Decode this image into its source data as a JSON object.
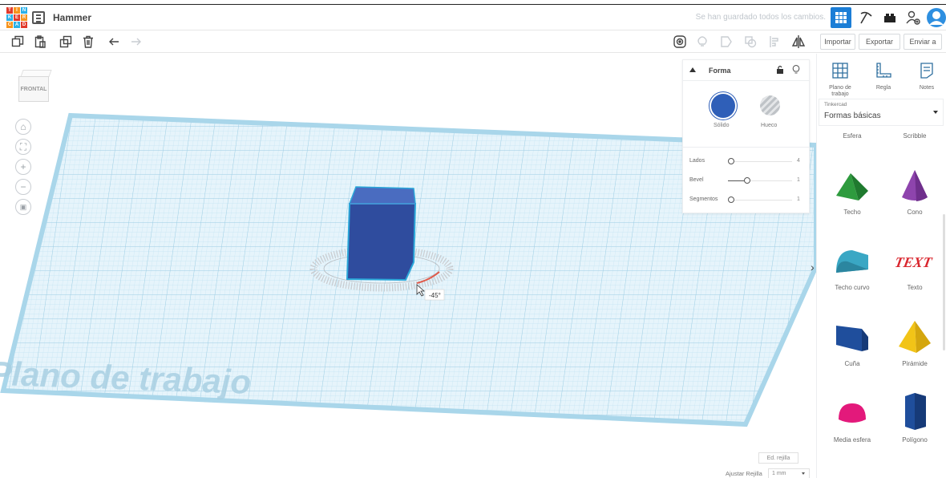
{
  "app": {
    "logo_letters": [
      "T",
      "I",
      "N",
      "K",
      "E",
      "R",
      "C",
      "A",
      "D"
    ],
    "logo_colors": [
      "#e23a2b",
      "#f7941d",
      "#2bb0e8",
      "#2bb0e8",
      "#e23a2b",
      "#f7941d",
      "#f7941d",
      "#2bb0e8",
      "#e23a2b"
    ],
    "design_name": "Hammer",
    "save_status": "Se han guardado todos los cambios."
  },
  "topbar": {
    "icons": [
      "grid-view-icon",
      "pickaxe-icon",
      "brick-icon",
      "add-user-icon",
      "avatar"
    ],
    "accent": "#1c7ed6"
  },
  "toolbar": {
    "left_icons": [
      "copy-icon",
      "paste-icon",
      "duplicate-icon",
      "delete-icon",
      "undo-icon",
      "redo-icon"
    ],
    "right_icons": [
      "show-all-icon",
      "bulb-icon",
      "group-icon",
      "ungroup-icon",
      "align-icon",
      "mirror-icon"
    ],
    "import_label": "Importar",
    "export_label": "Exportar",
    "send_label": "Enviar a"
  },
  "workplane": {
    "viewcube_label": "FRONTAL",
    "watermark": "Plano de trabajo",
    "rotation_label": "-45°",
    "edit_grid_label": "Ed. rejilla",
    "snap_label": "Ajustar Rejilla",
    "snap_value": "1 mm",
    "shape_color": "#2f4c9e",
    "selection_color": "#2ba7d9"
  },
  "inspector": {
    "title": "Forma",
    "solid_label": "Sólido",
    "hole_label": "Hueco",
    "solid_color": "#2f5fb8",
    "props": [
      {
        "label": "Lados",
        "value": "4",
        "level": 0.0
      },
      {
        "label": "Bevel",
        "value": "1",
        "level": 0.3
      },
      {
        "label": "Segmentos",
        "value": "1",
        "level": 0.0
      }
    ]
  },
  "panel": {
    "nav": [
      {
        "label": "Plano de trabajo",
        "icon": "workplane-icon"
      },
      {
        "label": "Regla",
        "icon": "ruler-icon"
      },
      {
        "label": "Notes",
        "icon": "notes-icon"
      }
    ],
    "library_small": "Tinkercad",
    "library_name": "Formas básicas",
    "partial_labels": [
      "Esfera",
      "Scribble"
    ],
    "shapes": [
      {
        "name": "Techo",
        "color": "#2e9b3e"
      },
      {
        "name": "Cono",
        "color": "#8e44ad"
      },
      {
        "name": "Techo curvo",
        "color": "#3aa7c4"
      },
      {
        "name": "Texto",
        "color": "#d9262e"
      },
      {
        "name": "Cuña",
        "color": "#1f4e9c"
      },
      {
        "name": "Pirámide",
        "color": "#f2c417"
      },
      {
        "name": "Media esfera",
        "color": "#e3197b"
      },
      {
        "name": "Polígono",
        "color": "#1f4e9c"
      }
    ]
  }
}
